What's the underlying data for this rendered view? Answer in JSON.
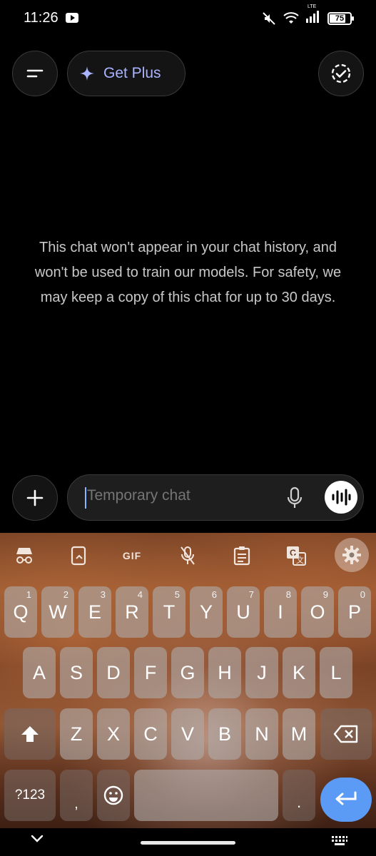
{
  "status_bar": {
    "time": "11:26",
    "network_label": "LTE",
    "battery": "75"
  },
  "app_bar": {
    "menu_icon": "menu-icon",
    "get_plus_label": "Get Plus",
    "sparkle_icon": "sparkle-icon",
    "temporary_chat_icon": "dashed-check-circle-icon",
    "accent_color": "#a9b3ff"
  },
  "main": {
    "message": "This chat won't appear in your chat history, and won't be used to train our models. For safety, we may keep a copy of this chat for up to 30 days."
  },
  "composer": {
    "placeholder": "Temporary chat",
    "plus_icon": "plus-icon",
    "mic_icon": "mic-icon",
    "voice_icon": "voice-waveform-icon"
  },
  "keyboard": {
    "toolbar": [
      "incognito-icon",
      "sticker-icon",
      "GIF",
      "mic-off-icon",
      "clipboard-icon",
      "translate-icon",
      "gear-icon"
    ],
    "row1": [
      {
        "label": "Q",
        "hint": "1"
      },
      {
        "label": "W",
        "hint": "2"
      },
      {
        "label": "E",
        "hint": "3"
      },
      {
        "label": "R",
        "hint": "4"
      },
      {
        "label": "T",
        "hint": "5"
      },
      {
        "label": "Y",
        "hint": "6"
      },
      {
        "label": "U",
        "hint": "7"
      },
      {
        "label": "I",
        "hint": "8"
      },
      {
        "label": "O",
        "hint": "9"
      },
      {
        "label": "P",
        "hint": "0"
      }
    ],
    "row2": [
      "A",
      "S",
      "D",
      "F",
      "G",
      "H",
      "J",
      "K",
      "L"
    ],
    "row3": [
      "Z",
      "X",
      "C",
      "V",
      "B",
      "N",
      "M"
    ],
    "symbols_label": "?123",
    "comma_label": ",",
    "period_label": ".",
    "enter_color": "#5b9bf6"
  }
}
